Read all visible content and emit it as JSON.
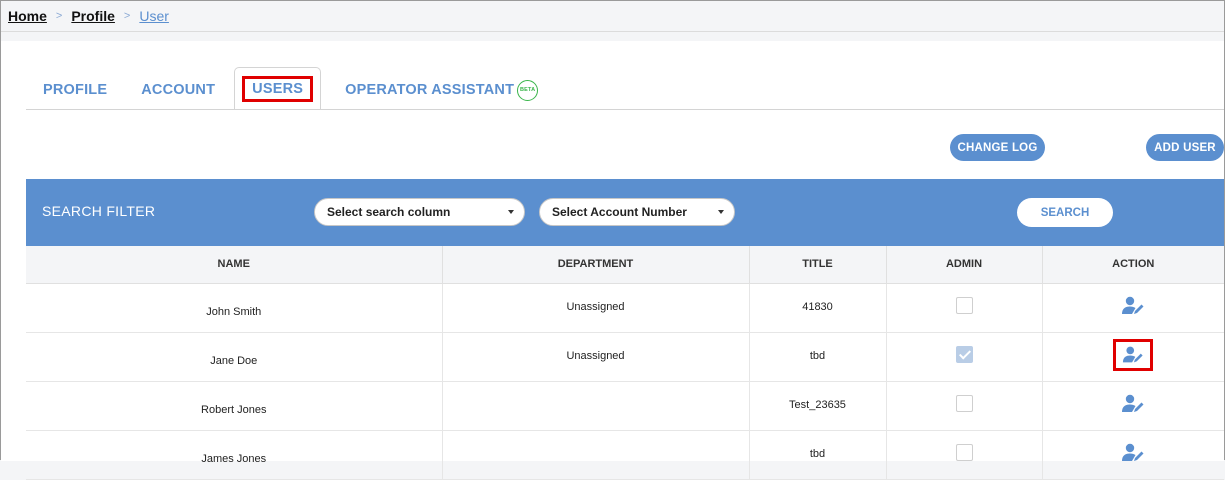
{
  "breadcrumb": {
    "home": "Home",
    "profile": "Profile",
    "user": "User",
    "separator": ">"
  },
  "tabs": [
    {
      "label": "PROFILE"
    },
    {
      "label": "ACCOUNT"
    },
    {
      "label": "USERS",
      "active": true
    },
    {
      "label": "OPERATOR ASSISTANT",
      "badge": "BETA"
    }
  ],
  "toolbar": {
    "change_log": "CHANGE LOG",
    "add_user": "ADD USER"
  },
  "filter": {
    "title": "SEARCH FILTER",
    "column_select": "Select search column",
    "account_select": "Select Account Number",
    "search_button": "SEARCH"
  },
  "table": {
    "headers": [
      "NAME",
      "DEPARTMENT",
      "TITLE",
      "ADMIN",
      "ACTION"
    ],
    "rows": [
      {
        "name": "John Smith",
        "department": "Unassigned",
        "title": "41830",
        "admin": false
      },
      {
        "name": "Jane Doe",
        "department": "Unassigned",
        "title": "tbd",
        "admin": true
      },
      {
        "name": "Robert Jones",
        "department": "",
        "title": "Test_23635",
        "admin": false
      },
      {
        "name": "James Jones",
        "department": "",
        "title": "tbd",
        "admin": false
      }
    ]
  },
  "colors": {
    "accent": "#5b8fcf",
    "highlight": "#e00000",
    "beta": "#39b54a"
  },
  "icons": {
    "action": "edit-user-icon",
    "select_arrow": "caret-down-icon"
  }
}
